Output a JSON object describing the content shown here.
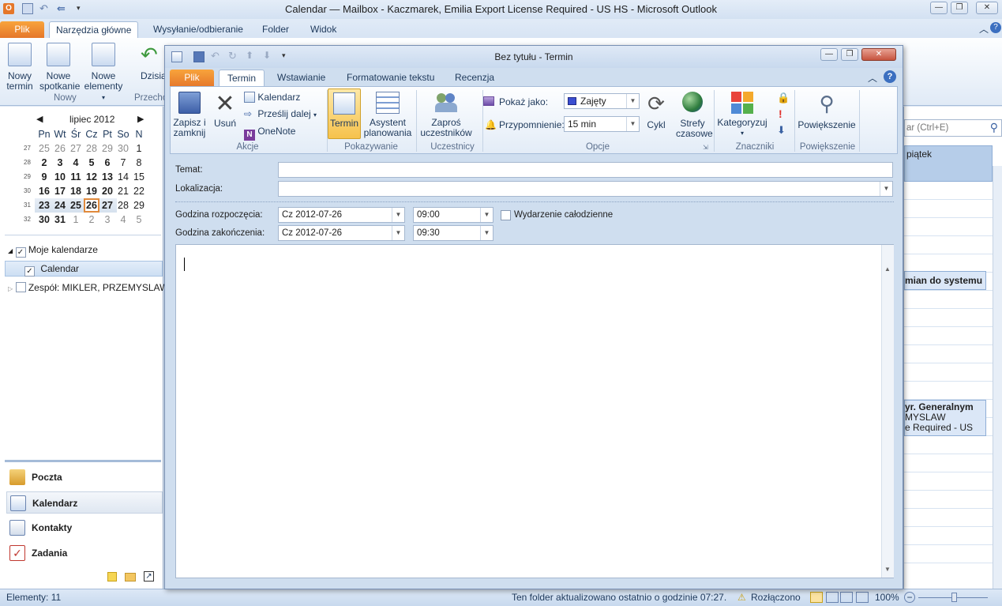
{
  "outer": {
    "title": "Calendar — Mailbox - Kaczmarek, Emilia     Export License Required - US HS  -  Microsoft Outlook",
    "tabs": [
      "Plik",
      "Narzędzia główne",
      "Wysyłanie/odbieranie",
      "Folder",
      "Widok"
    ],
    "ribbon": {
      "new_appointment": [
        "Nowy",
        "termin"
      ],
      "new_meeting": [
        "Nowe",
        "spotkanie"
      ],
      "new_items": [
        "Nowe",
        "elementy"
      ],
      "today": "Dzisia",
      "group_new": "Nowy",
      "group_goto": "Przecho"
    }
  },
  "minical": {
    "month": "lipiec 2012",
    "prev": "◀",
    "next": "▶",
    "weekdays": [
      "Pn",
      "Wt",
      "Śr",
      "Cz",
      "Pt",
      "So",
      "N"
    ],
    "weeks": [
      {
        "wk": "27",
        "days": [
          "25",
          "26",
          "27",
          "28",
          "29",
          "30",
          "1"
        ]
      },
      {
        "wk": "28",
        "days": [
          "2",
          "3",
          "4",
          "5",
          "6",
          "7",
          "8"
        ]
      },
      {
        "wk": "29",
        "days": [
          "9",
          "10",
          "11",
          "12",
          "13",
          "14",
          "15"
        ]
      },
      {
        "wk": "30",
        "days": [
          "16",
          "17",
          "18",
          "19",
          "20",
          "21",
          "22"
        ]
      },
      {
        "wk": "31",
        "days": [
          "23",
          "24",
          "25",
          "26",
          "27",
          "28",
          "29"
        ]
      },
      {
        "wk": "32",
        "days": [
          "30",
          "31",
          "1",
          "2",
          "3",
          "4",
          "5"
        ]
      }
    ],
    "today": "26"
  },
  "calendars": {
    "my_calendars": "Moje kalendarze",
    "calendar": "Calendar",
    "team": "Zespół: MIKLER, PRZEMYSLAW"
  },
  "nav": {
    "mail": "Poczta",
    "calendar": "Kalendarz",
    "contacts": "Kontakty",
    "tasks": "Zadania"
  },
  "right": {
    "search_placeholder": "ar (Ctrl+E)",
    "day_header": "piątek",
    "appt1": "mian do systemu H",
    "appt2_line1": "yr. Generalnym",
    "appt2_line2": "MYSLAW",
    "appt2_line3": "e Required - US"
  },
  "status": {
    "items": "Elementy: 11",
    "updated": "Ten folder aktualizowano ostatnio o godzinie 07:27.",
    "offline": "Rozłączono",
    "zoom": "100%"
  },
  "dialog": {
    "title": "Bez tytułu  -  Termin",
    "tabs": [
      "Plik",
      "Termin",
      "Wstawianie",
      "Formatowanie tekstu",
      "Recenzja"
    ],
    "ribbon": {
      "save_close": [
        "Zapisz i",
        "zamknij"
      ],
      "delete": "Usuń",
      "calendar": "Kalendarz",
      "forward": "Prześlij dalej",
      "onenote": "OneNote",
      "group_actions": "Akcje",
      "appointment": "Termin",
      "scheduling": [
        "Asystent",
        "planowania"
      ],
      "group_show": "Pokazywanie",
      "invite": [
        "Zaproś",
        "uczestników"
      ],
      "group_attendees": "Uczestnicy",
      "show_as_label": "Pokaż jako:",
      "show_as_value": "Zajęty",
      "reminder_label": "Przypomnienie:",
      "reminder_value": "15 min",
      "recurrence": "Cykl",
      "timezones": [
        "Strefy",
        "czasowe"
      ],
      "group_options": "Opcje",
      "categorize": "Kategoryzuj",
      "group_tags": "Znaczniki",
      "zoom": "Powiększenie",
      "group_zoom": "Powiększenie"
    },
    "form": {
      "subject_label": "Temat:",
      "subject_value": "",
      "location_label": "Lokalizacja:",
      "location_value": "",
      "start_label": "Godzina rozpoczęcia:",
      "start_date": "Cz 2012-07-26",
      "start_time": "09:00",
      "allday_label": "Wydarzenie całodzienne",
      "end_label": "Godzina zakończenia:",
      "end_date": "Cz 2012-07-26",
      "end_time": "09:30"
    }
  },
  "colors": {
    "file_tab": "#e5772a",
    "ribbon_bg": "#e3ecf7",
    "selected_tab": "#ffffff",
    "today_border": "#e08a3c"
  }
}
